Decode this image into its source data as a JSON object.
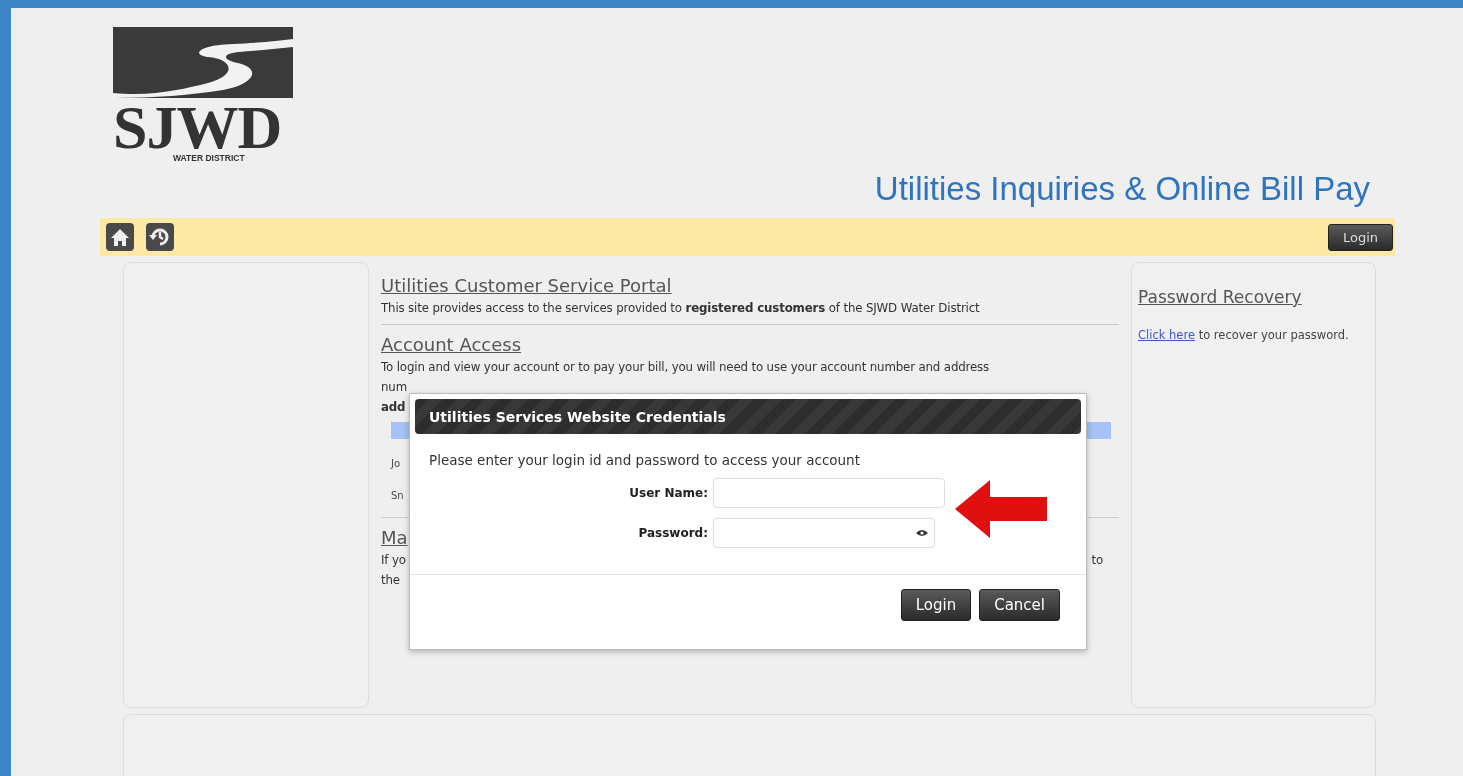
{
  "logo": {
    "initials": "SJWD",
    "subtitle": "WATER DISTRICT"
  },
  "header": {
    "title": "Utilities Inquiries & Online Bill Pay"
  },
  "toolbar": {
    "login_button": "Login"
  },
  "center": [
    {
      "kind": "heading",
      "text": "Utilities Customer Service Portal"
    },
    {
      "kind": "paragraph",
      "text": "This site provides access to the services provided to **registered customers** of the SJWD Water District"
    },
    {
      "kind": "rule"
    },
    {
      "kind": "heading",
      "text": "Account Access"
    },
    {
      "kind": "paragraph",
      "text": "To login and view your account or to pay your bill, you will need to use your account number and address"
    },
    {
      "kind": "paragraph",
      "text": "num"
    },
    {
      "kind": "note",
      "text": "add"
    },
    {
      "kind": "table_header"
    },
    {
      "kind": "table_row",
      "text": "Jo"
    },
    {
      "kind": "table_row",
      "text": "Sn"
    },
    {
      "kind": "rule"
    },
    {
      "kind": "heading",
      "text": "Ma"
    },
    {
      "kind": "split_line",
      "left": "If yo",
      "right": "to"
    },
    {
      "kind": "paragraph",
      "text": "the"
    }
  ],
  "password_recovery": {
    "heading": "Password Recovery",
    "link": "Click here",
    "text": "to recover your password."
  },
  "dialog": {
    "title": "Utilities Services Website Credentials",
    "prompt": "Please enter your login id and password to access your account",
    "fields": [
      {
        "kind": "text",
        "label": "User Name:"
      },
      {
        "kind": "password",
        "label": "Password:"
      }
    ],
    "buttons": [
      "Login",
      "Cancel"
    ]
  }
}
